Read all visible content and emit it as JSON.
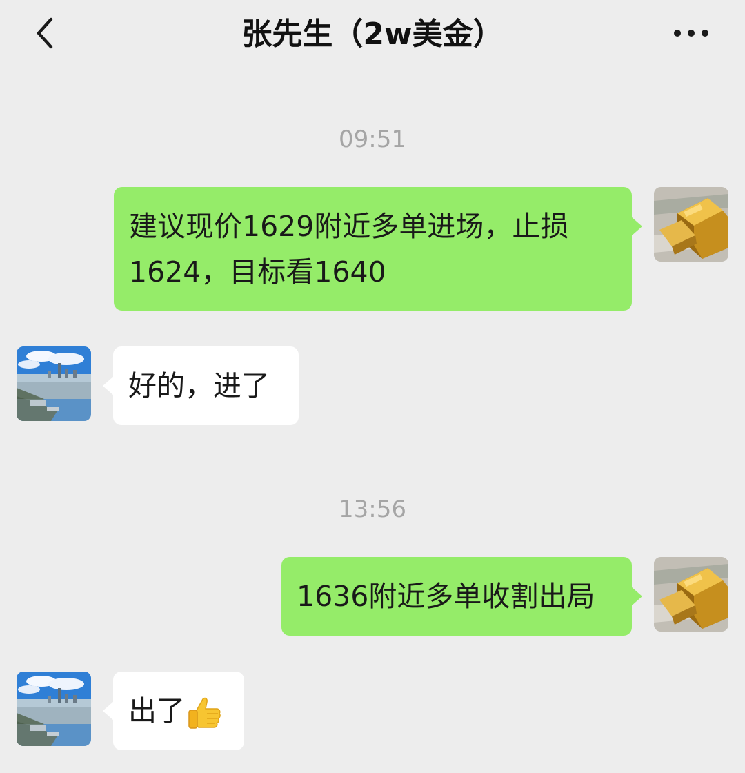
{
  "header": {
    "title": "张先生（2w美金）",
    "back_icon": "chevron-left-icon",
    "more_icon": "more-dots-icon"
  },
  "messages": [
    {
      "type": "timestamp",
      "text": "09:51"
    },
    {
      "type": "outgoing",
      "text": "建议现价1629附近多单进场，止损\n1624，目标看1640"
    },
    {
      "type": "incoming",
      "text": "好的，进了"
    },
    {
      "type": "timestamp",
      "text": "13:56"
    },
    {
      "type": "outgoing",
      "text": "1636附近多单收割出局"
    },
    {
      "type": "incoming",
      "text": "出了",
      "emoji": "thumbs-up-emoji"
    }
  ],
  "colors": {
    "background": "#ededed",
    "outgoing_bubble": "#95ec69",
    "incoming_bubble": "#ffffff",
    "timestamp_text": "#a5a5a5"
  }
}
